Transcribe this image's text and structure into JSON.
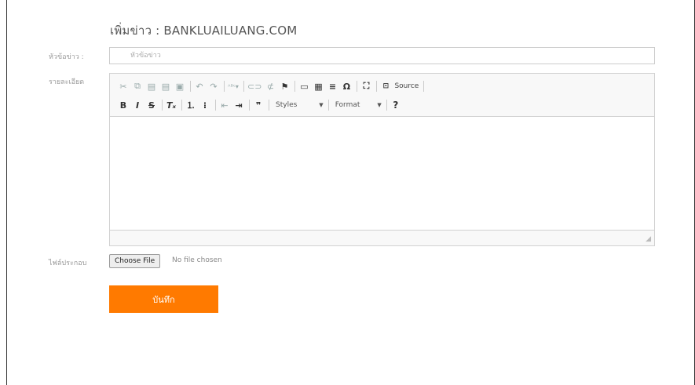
{
  "page_title": "เพิ่มข่าว : BANKLUAILUANG.COM",
  "labels": {
    "headline": "หัวข้อข่าว :",
    "detail": "รายละเอียด",
    "attachment": "ไฟล์ประกอบ"
  },
  "headline_input": {
    "placeholder": "หัวข้อข่าว",
    "value": ""
  },
  "editor": {
    "row1_source_label": "Source",
    "styles_label": "Styles",
    "format_label": "Format"
  },
  "file": {
    "button_label": "Choose File",
    "status": "No file chosen"
  },
  "submit_label": "บันทึก",
  "colors": {
    "accent": "#ff7a00"
  }
}
